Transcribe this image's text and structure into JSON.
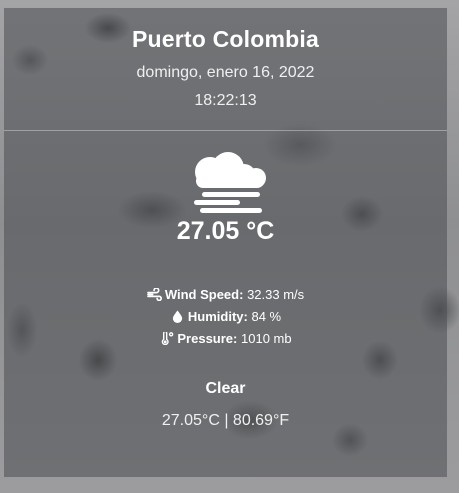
{
  "location": {
    "city": "Puerto Colombia",
    "date": "domingo, enero 16, 2022",
    "time": "18:22:13"
  },
  "current": {
    "icon": "fog-cloud-icon",
    "temperature": "27.05 °C"
  },
  "details": {
    "wind_label": "Wind Speed:",
    "wind_value": "32.33 m/s",
    "humidity_label": "Humidity:",
    "humidity_value": "84 %",
    "pressure_label": "Pressure:",
    "pressure_value": "1010 mb"
  },
  "condition": {
    "description": "Clear",
    "temps": "27.05°C | 80.69°F"
  },
  "colors": {
    "text": "#ffffff",
    "panel_overlay": "#4b4c50"
  }
}
